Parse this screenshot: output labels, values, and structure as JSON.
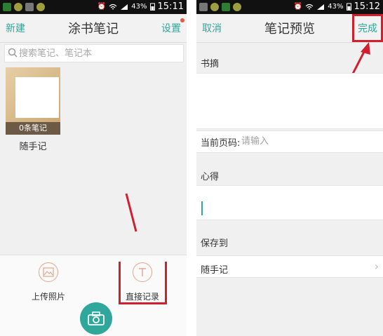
{
  "left": {
    "status": {
      "battery": "43%",
      "time": "15:11"
    },
    "header": {
      "left_action": "新建",
      "title": "涂书笔记",
      "right_action": "设置"
    },
    "search": {
      "placeholder": "搜索笔记、笔记本"
    },
    "notebook": {
      "count_label": "0条笔记",
      "name": "随手记"
    },
    "bottom": {
      "upload_label": "上传照片",
      "direct_label": "直接记录"
    }
  },
  "right": {
    "status": {
      "battery": "43%",
      "time": "15:12"
    },
    "header": {
      "left_action": "取消",
      "title": "笔记预览",
      "right_action": "完成"
    },
    "form": {
      "excerpt_label": "书摘",
      "page_label": "当前页码:",
      "page_placeholder": "请输入",
      "reflection_label": "心得",
      "save_to_label": "保存到",
      "save_to_value": "随手记"
    }
  },
  "colors": {
    "accent": "#2fa79b",
    "highlight": "#d0202e",
    "notebook_band": "#6c5a46"
  },
  "icons": [
    "search-icon",
    "photo-icon",
    "text-icon",
    "camera-icon",
    "chevron-right-icon",
    "wifi-icon",
    "signal-icon",
    "battery-icon",
    "alarm-icon"
  ]
}
